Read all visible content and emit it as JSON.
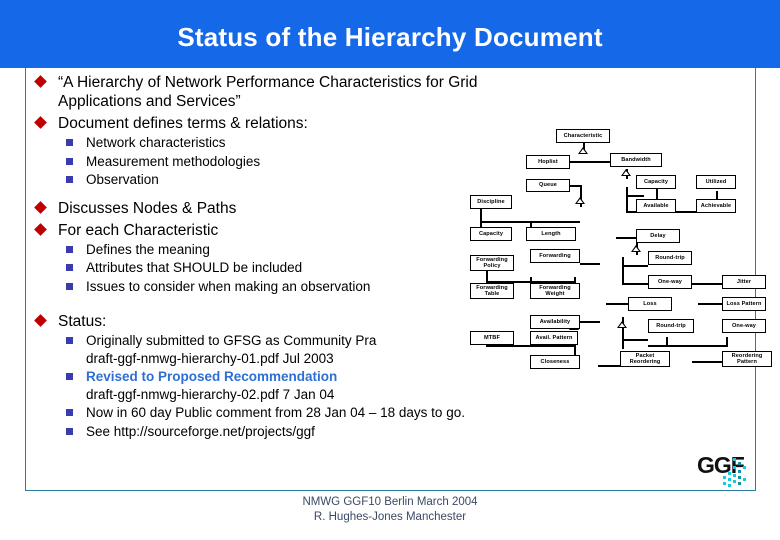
{
  "slide": {
    "title": "Status of the Hierarchy Document",
    "title_bg": "#1569e8",
    "accent_line": "#2a7e9b",
    "bullet1_color": "#c00000",
    "bullet2_color": "#3b3bb0",
    "highlight_color": "#2d6fd4"
  },
  "bullets": {
    "b1": "“A Hierarchy of Network Performance Characteristics for Grid Applications and Services”",
    "b2": "Document defines terms & relations:",
    "b2_sub": [
      "Network characteristics",
      "Measurement methodologies",
      "Observation"
    ],
    "b3": "Discusses Nodes & Paths",
    "b4": "For each Characteristic",
    "b4_sub": [
      "Defines the meaning",
      "Attributes that SHOULD be included",
      "Issues to consider when making an observation"
    ],
    "b5": "Status:",
    "b5_sub": [
      {
        "line1": "Originally submitted to GFSG as Community Pra",
        "line2": "draft-ggf-nmwg-hierarchy-01.pdf Jul 2003",
        "highlight": false
      },
      {
        "line1": "Revised to Proposed Recommendation",
        "line2": "draft-ggf-nmwg-hierarchy-02.pdf  7 Jan 04",
        "highlight": true
      },
      {
        "line1": "Now in 60 day Public comment from  28 Jan 04 – 18 days to go.",
        "line2": "",
        "highlight": false
      },
      {
        "line1": "See http://sourceforge.net/projects/ggf",
        "line2": "",
        "highlight": false
      }
    ]
  },
  "footer": {
    "line1": "NMWG GGF10 Berlin March 2004",
    "line2": "R. Hughes-Jones  Manchester"
  },
  "logo": {
    "text": "GGF"
  },
  "diagram": {
    "nodes": {
      "characteristic": "Characteristic",
      "hoplist": "Hoplist",
      "bandwidth": "Bandwidth",
      "queue": "Queue",
      "capacity_bw": "Capacity",
      "utilized": "Utilized",
      "discipline": "Discipline",
      "available": "Available",
      "achievable": "Achievable",
      "capacity_q": "Capacity",
      "length": "Length",
      "delay": "Delay",
      "forwarding": "Forwarding",
      "roundtrip_d": "Round-trip",
      "forwarding_policy": "Forwarding Policy",
      "oneway_d": "One-way",
      "jitter": "Jitter",
      "forwarding_table": "Forwarding Table",
      "forwarding_weight": "Forwarding Weight",
      "loss": "Loss",
      "loss_pattern": "Loss Pattern",
      "availability": "Availability",
      "roundtrip_l": "Round-trip",
      "oneway_l": "One-way",
      "mtbf": "MTBF",
      "avail_pattern": "Avail. Pattern",
      "packet_reordering": "Packet Reordering",
      "reordering_pattern": "Reordering Pattern",
      "closeness": "Closeness"
    }
  }
}
